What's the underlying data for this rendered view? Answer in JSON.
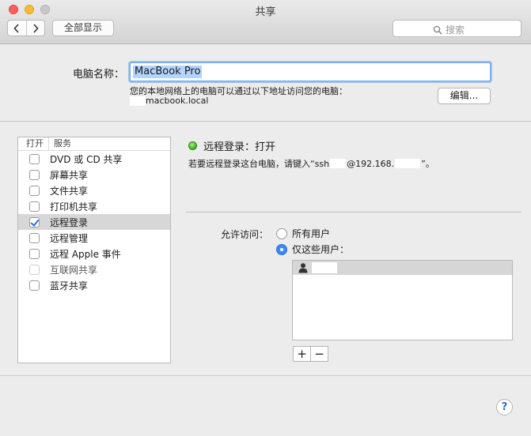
{
  "window": {
    "title": "共享"
  },
  "toolbar": {
    "show_all_label": "全部显示",
    "search_placeholder": "搜索"
  },
  "computer_name": {
    "label": "电脑名称：",
    "value": "MacBook Pro",
    "hint": "您的本地网络上的电脑可以通过以下地址访问您的电脑：",
    "local_address": "macbook.local",
    "edit_label": "编辑..."
  },
  "services": {
    "header_on": "打开",
    "header_service": "服务",
    "items": [
      {
        "label": "DVD 或 CD 共享",
        "checked": false
      },
      {
        "label": "屏幕共享",
        "checked": false
      },
      {
        "label": "文件共享",
        "checked": false
      },
      {
        "label": "打印机共享",
        "checked": false
      },
      {
        "label": "远程登录",
        "checked": true,
        "selected": true
      },
      {
        "label": "远程管理",
        "checked": false
      },
      {
        "label": "远程 Apple 事件",
        "checked": false
      },
      {
        "label": "互联网共享",
        "checked": false,
        "disabled": true
      },
      {
        "label": "蓝牙共享",
        "checked": false
      }
    ]
  },
  "detail": {
    "status_text": "远程登录：打开",
    "status_color": "#35b21f",
    "instruction_prefix": "若要远程登录这台电脑，请键入“ssh",
    "instruction_mid": "@192.168.",
    "instruction_suffix": "”。",
    "allow_access_label": "允许访问：",
    "radio_all_users": "所有用户",
    "radio_only_users": "仅这些用户：",
    "selected_radio": "only_users",
    "add_label": "+",
    "remove_label": "−"
  },
  "help": {
    "label": "?"
  }
}
